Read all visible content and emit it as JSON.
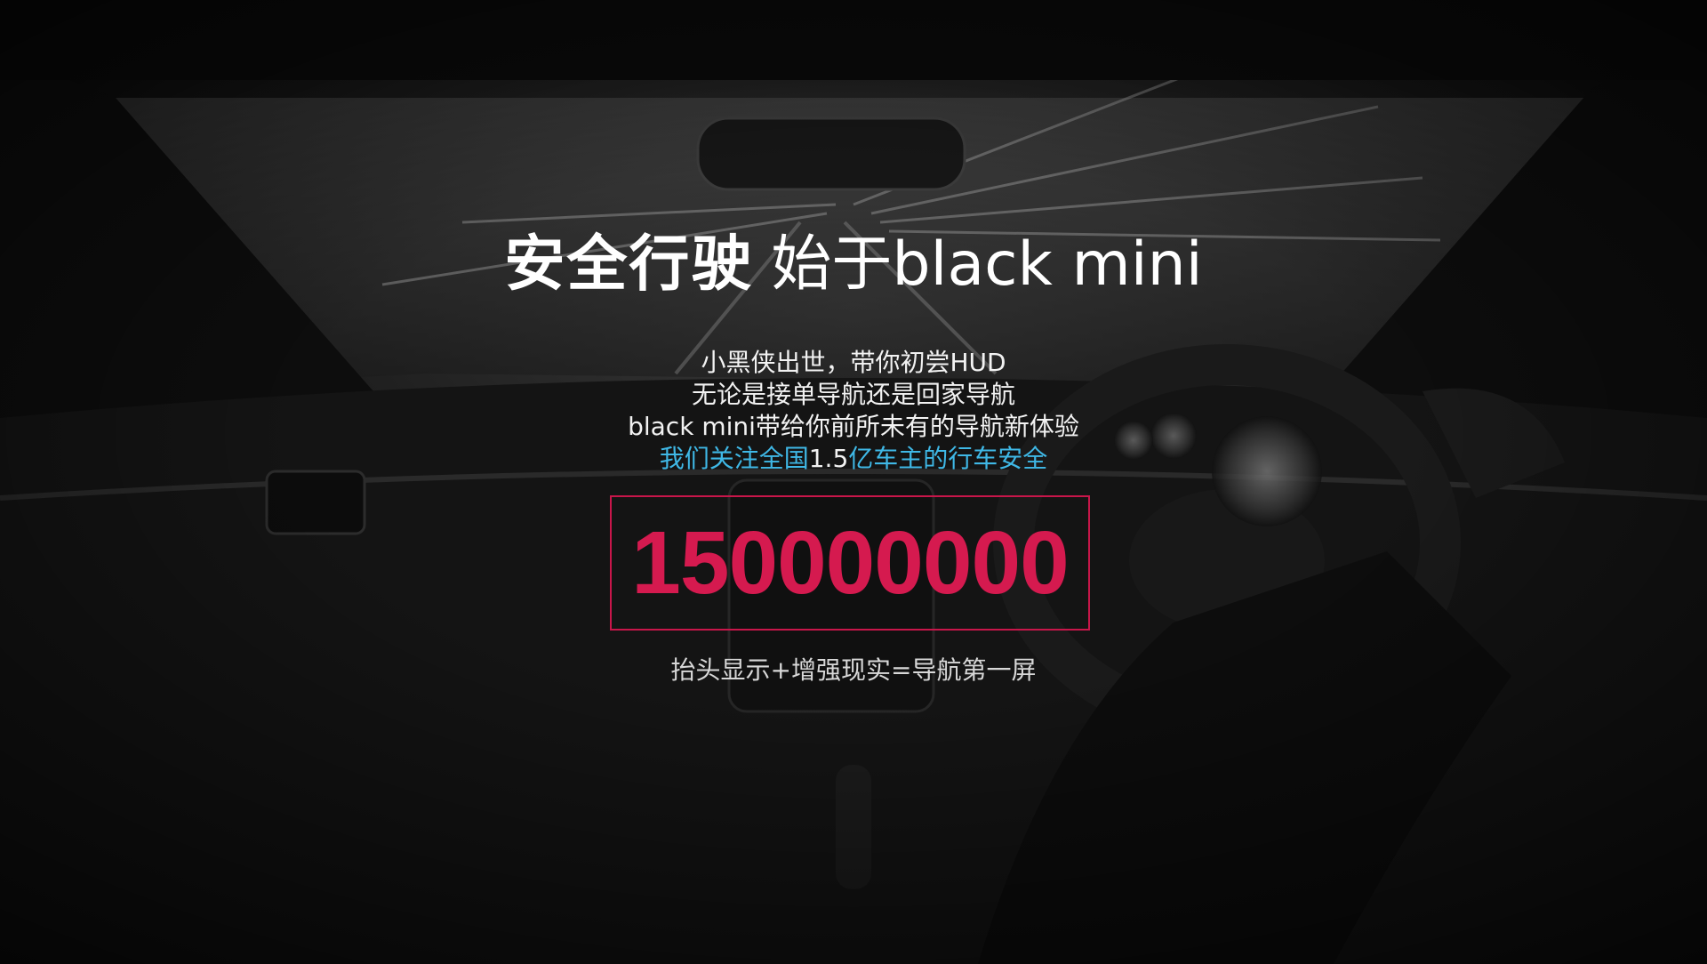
{
  "headline": {
    "bold_part": "安全行驶",
    "light_part": "始于black mini"
  },
  "body": {
    "lines": [
      "小黑侠出世，带你初尝HUD",
      "无论是接单导航还是回家导航",
      "black mini带给你前所未有的导航新体验"
    ],
    "highlight_before": "我们关注全国",
    "highlight_number": "1.5",
    "highlight_after": "亿车主的行车安全"
  },
  "counter": {
    "value": "150000000",
    "border_color": "#c8164a",
    "text_color": "#d51a4f"
  },
  "tagline": "抬头显示+增强现实=导航第一屏",
  "colors": {
    "highlight": "#3fb8e6"
  }
}
